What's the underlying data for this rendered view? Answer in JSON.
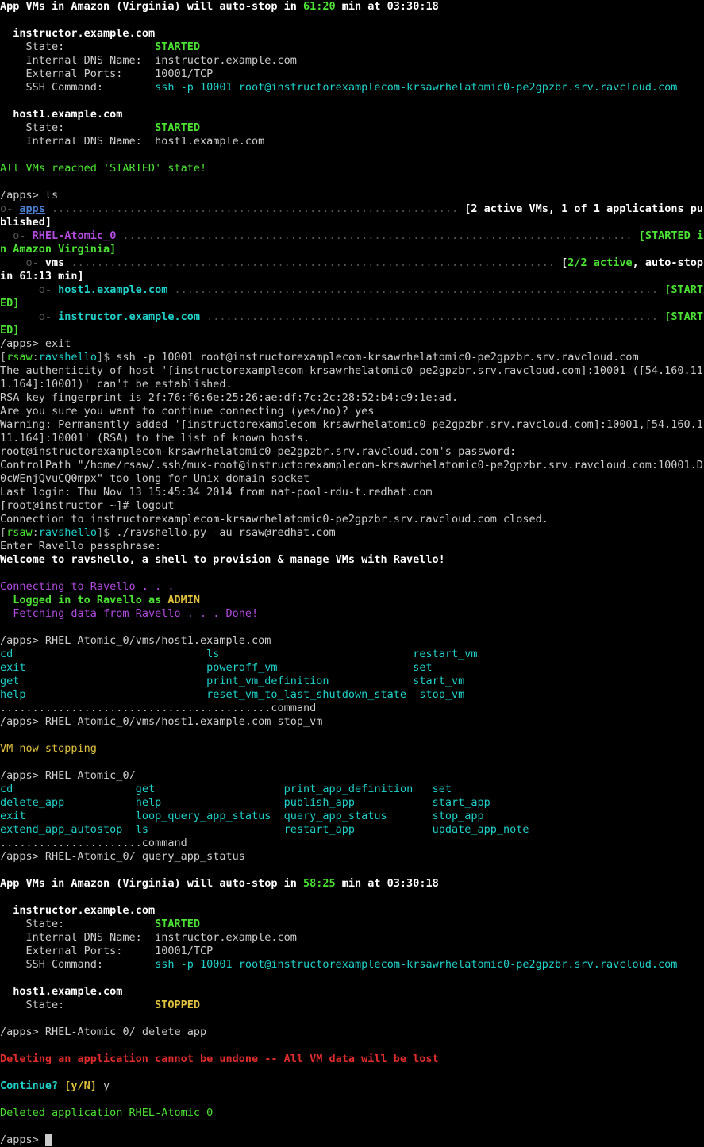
{
  "header1": {
    "prefix": "App VMs in Amazon (Virginia) will auto-stop in ",
    "time": "61:20",
    "suffix": " min at 03:30:18"
  },
  "vm1": {
    "name": "instructor.example.com",
    "state_label": "State:",
    "state_value": "STARTED",
    "dns_label": "Internal DNS Name:",
    "dns_value": "instructor.example.com",
    "ports_label": "External Ports:",
    "ports_value": "10001/TCP",
    "ssh_label": "SSH Command:",
    "ssh_value": "ssh -p 10001 root@instructorexamplecom-krsawrhelatomic0-pe2gpzbr.srv.ravcloud.com"
  },
  "vm2": {
    "name": "host1.example.com",
    "state_label": "State:",
    "state_value": "STARTED",
    "dns_label": "Internal DNS Name:",
    "dns_value": "host1.example.com"
  },
  "all_started": "All VMs reached 'STARTED' state!",
  "prompt1": "/apps> ",
  "cmd_ls": "ls",
  "tree": {
    "apps": "apps",
    "apps_status": "[2 active VMs, 1 of 1 applications published]",
    "rhel": "RHEL-Atomic_0",
    "rhel_status": "[STARTED in Amazon Virginia]",
    "vms": "vms",
    "vms_status_prefix": "[",
    "vms_status_count": "2/2 active",
    "vms_status_rest": ", auto-stop in 61:13 min]",
    "host1": "host1.example.com",
    "host1_status": "[STARTED]",
    "instr": "instructor.example.com",
    "instr_status": "[STARTED]"
  },
  "cmd_exit": "exit",
  "shell_prompt": {
    "user": "rsaw",
    "sep": ":",
    "host": "ravshello",
    "end": "]$ "
  },
  "ssh_cmd": "ssh -p 10001 root@instructorexamplecom-krsawrhelatomic0-pe2gpzbr.srv.ravcloud.com",
  "ssh_block": {
    "l1": "The authenticity of host '[instructorexamplecom-krsawrhelatomic0-pe2gpzbr.srv.ravcloud.com]:10001 ([54.160.111.164]:10001)' can't be established.",
    "l2": "RSA key fingerprint is 2f:76:f6:6e:25:26:ae:df:7c:2c:28:52:b4:c9:1e:ad.",
    "l3": "Are you sure you want to continue connecting (yes/no)? yes",
    "l4": "Warning: Permanently added '[instructorexamplecom-krsawrhelatomic0-pe2gpzbr.srv.ravcloud.com]:10001,[54.160.111.164]:10001' (RSA) to the list of known hosts.",
    "l5": "root@instructorexamplecom-krsawrhelatomic0-pe2gpzbr.srv.ravcloud.com's password:",
    "l6": "ControlPath \"/home/rsaw/.ssh/mux-root@instructorexamplecom-krsawrhelatomic0-pe2gpzbr.srv.ravcloud.com:10001.D0cWEnjQvuCQ0mpx\" too long for Unix domain socket",
    "l7": "Last login: Thu Nov 13 15:45:34 2014 from nat-pool-rdu-t.redhat.com",
    "l8": "[root@instructor ~]# logout",
    "l9": "Connection to instructorexamplecom-krsawrhelatomic0-pe2gpzbr.srv.ravcloud.com closed."
  },
  "ravshello_cmd": "./ravshello.py -au rsaw@redhat.com",
  "passphrase": "Enter Ravello passphrase:",
  "welcome": "Welcome to ravshello, a shell to provision & manage VMs with Ravello!",
  "connecting": "Connecting to Ravello . . .",
  "logged_prefix": "Logged in to Ravello as ",
  "logged_role": "ADMIN",
  "fetching": "Fetching data from Ravello . . . Done!",
  "cmd_vm_path": "RHEL-Atomic_0/vms/host1.example.com",
  "vm_cmds": {
    "c1a": "cd",
    "c1b": "ls",
    "c1c": "restart_vm",
    "c2a": "exit",
    "c2b": "poweroff_vm",
    "c2c": "set",
    "c3a": "get",
    "c3b": "print_vm_definition",
    "c3c": "start_vm",
    "c4a": "help",
    "c4b": "reset_vm_to_last_shutdown_state",
    "c4c": "stop_vm"
  },
  "dotted_command": "..........................................command",
  "cmd_stop": "RHEL-Atomic_0/vms/host1.example.com stop_vm",
  "stopping": "VM now stopping",
  "cmd_app_path": "RHEL-Atomic_0/",
  "app_cmds": {
    "r1c1": "cd",
    "r1c2": "get",
    "r1c3": "print_app_definition",
    "r1c4": "set",
    "r2c1": "delete_app",
    "r2c2": "help",
    "r2c3": "publish_app",
    "r2c4": "start_app",
    "r3c1": "exit",
    "r3c2": "loop_query_app_status",
    "r3c3": "query_app_status",
    "r3c4": "stop_app",
    "r4c1": "extend_app_autostop",
    "r4c2": "ls",
    "r4c3": "restart_app",
    "r4c4": "update_app_note"
  },
  "dotted_command2": "......................command",
  "cmd_query": "RHEL-Atomic_0/ query_app_status",
  "header2": {
    "prefix": "App VMs in Amazon (Virginia) will auto-stop in ",
    "time": "58:25",
    "suffix": " min at 03:30:18"
  },
  "vm3_state": "STOPPED",
  "cmd_delete": "RHEL-Atomic_0/ delete_app",
  "delete_warn": "Deleting an application cannot be undone -- All VM data will be lost",
  "continue_q": "Continue? ",
  "continue_opts": "[y/N]",
  "continue_ans": " y",
  "deleted": "Deleted application RHEL-Atomic_0"
}
